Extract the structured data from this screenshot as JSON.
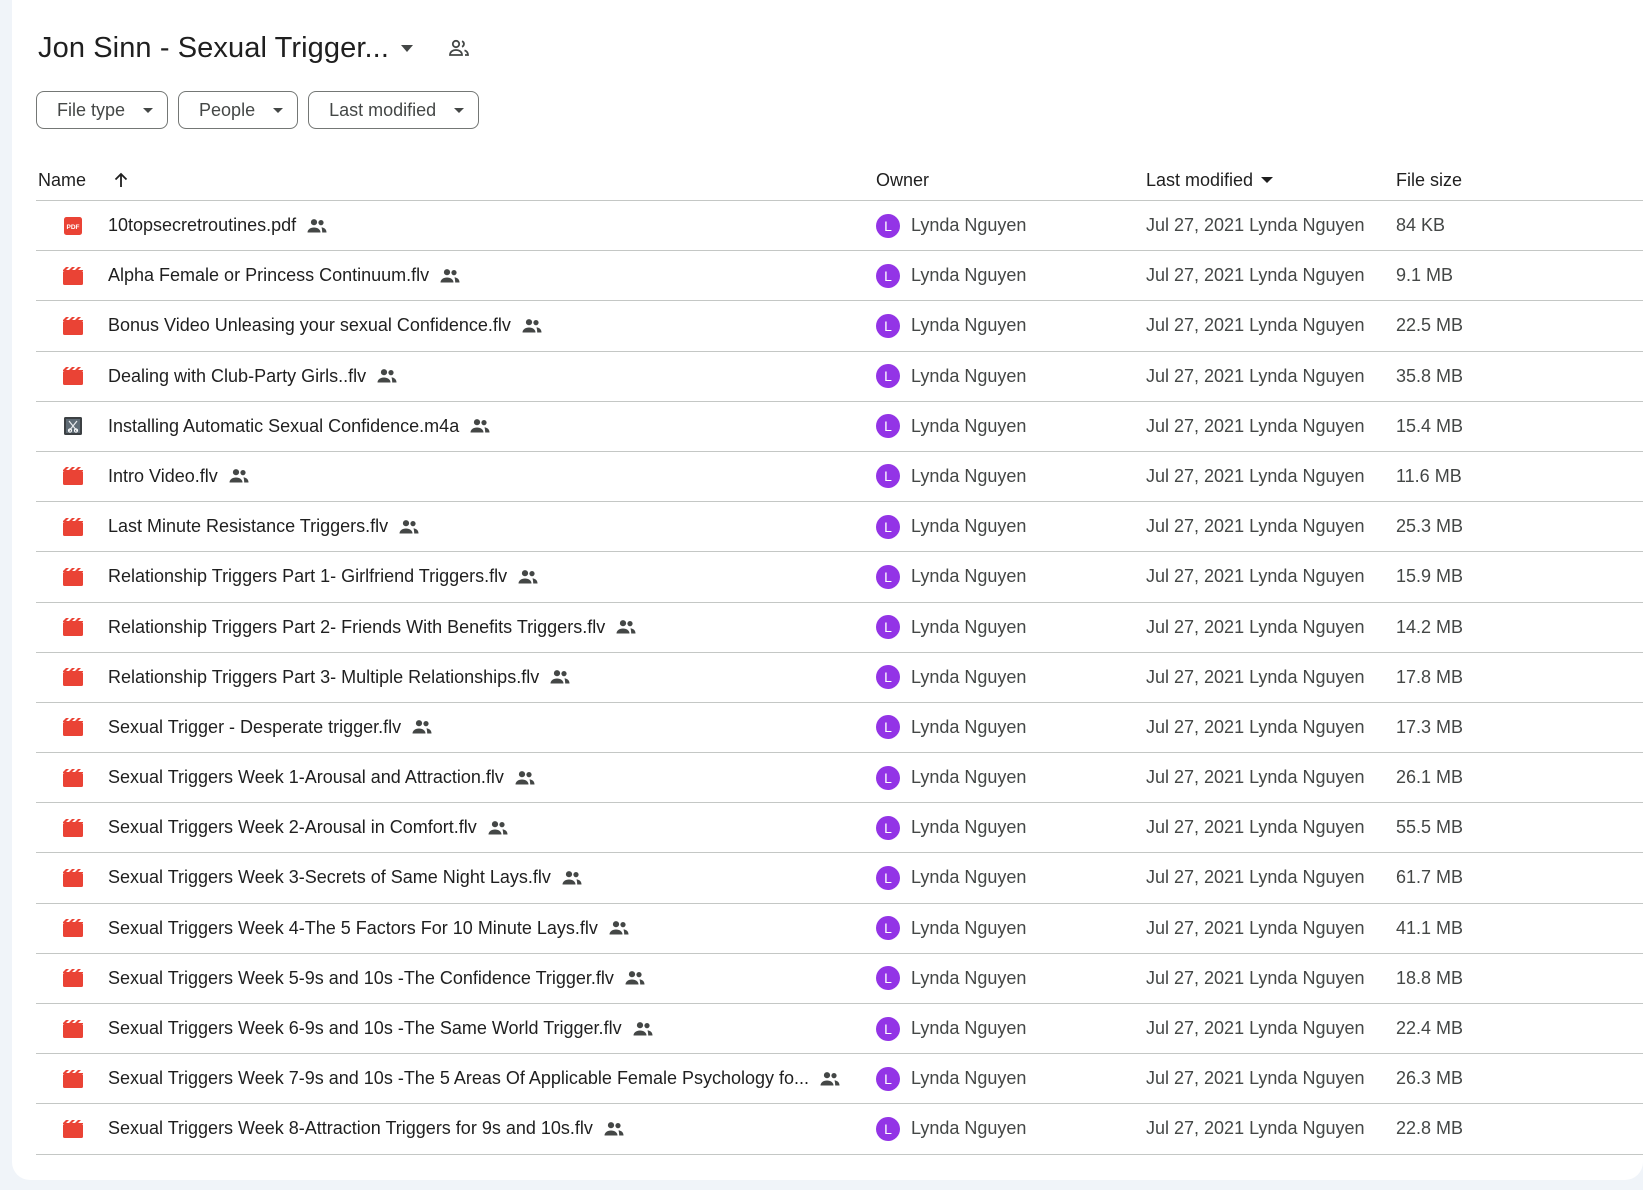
{
  "folder": {
    "title": "Jon Sinn - Sexual Trigger..."
  },
  "filters": [
    "File type",
    "People",
    "Last modified"
  ],
  "columns": {
    "name": "Name",
    "owner": "Owner",
    "last_modified": "Last modified",
    "file_size": "File size"
  },
  "colors": {
    "pdf": "#ea4335",
    "video": "#ea4335",
    "avatar": "#9334e6",
    "audio_thumb": "#3c4043"
  },
  "files": [
    {
      "icon": "pdf-icon",
      "name": "10topsecretroutines.pdf",
      "owner": "Lynda Nguyen",
      "initial": "L",
      "modified": "Jul 27, 2021 Lynda Nguyen",
      "size": "84 KB"
    },
    {
      "icon": "video-icon",
      "name": "Alpha Female or Princess Continuum.flv",
      "owner": "Lynda Nguyen",
      "initial": "L",
      "modified": "Jul 27, 2021 Lynda Nguyen",
      "size": "9.1 MB"
    },
    {
      "icon": "video-icon",
      "name": "Bonus Video Unleasing your sexual Confidence.flv",
      "owner": "Lynda Nguyen",
      "initial": "L",
      "modified": "Jul 27, 2021 Lynda Nguyen",
      "size": "22.5 MB"
    },
    {
      "icon": "video-icon",
      "name": "Dealing with Club-Party Girls..flv",
      "owner": "Lynda Nguyen",
      "initial": "L",
      "modified": "Jul 27, 2021 Lynda Nguyen",
      "size": "35.8 MB"
    },
    {
      "icon": "audio-thumbnail-icon",
      "name": "Installing Automatic Sexual Confidence.m4a",
      "owner": "Lynda Nguyen",
      "initial": "L",
      "modified": "Jul 27, 2021 Lynda Nguyen",
      "size": "15.4 MB"
    },
    {
      "icon": "video-icon",
      "name": "Intro Video.flv",
      "owner": "Lynda Nguyen",
      "initial": "L",
      "modified": "Jul 27, 2021 Lynda Nguyen",
      "size": "11.6 MB"
    },
    {
      "icon": "video-icon",
      "name": "Last Minute Resistance Triggers.flv",
      "owner": "Lynda Nguyen",
      "initial": "L",
      "modified": "Jul 27, 2021 Lynda Nguyen",
      "size": "25.3 MB"
    },
    {
      "icon": "video-icon",
      "name": "Relationship Triggers Part 1- Girlfriend Triggers.flv",
      "owner": "Lynda Nguyen",
      "initial": "L",
      "modified": "Jul 27, 2021 Lynda Nguyen",
      "size": "15.9 MB"
    },
    {
      "icon": "video-icon",
      "name": "Relationship Triggers Part 2- Friends With Benefits Triggers.flv",
      "owner": "Lynda Nguyen",
      "initial": "L",
      "modified": "Jul 27, 2021 Lynda Nguyen",
      "size": "14.2 MB"
    },
    {
      "icon": "video-icon",
      "name": "Relationship Triggers Part 3- Multiple Relationships.flv",
      "owner": "Lynda Nguyen",
      "initial": "L",
      "modified": "Jul 27, 2021 Lynda Nguyen",
      "size": "17.8 MB"
    },
    {
      "icon": "video-icon",
      "name": "Sexual Trigger - Desperate trigger.flv",
      "owner": "Lynda Nguyen",
      "initial": "L",
      "modified": "Jul 27, 2021 Lynda Nguyen",
      "size": "17.3 MB"
    },
    {
      "icon": "video-icon",
      "name": "Sexual Triggers  Week 1-Arousal and Attraction.flv",
      "owner": "Lynda Nguyen",
      "initial": "L",
      "modified": "Jul 27, 2021 Lynda Nguyen",
      "size": "26.1 MB"
    },
    {
      "icon": "video-icon",
      "name": "Sexual Triggers  Week 2-Arousal in Comfort.flv",
      "owner": "Lynda Nguyen",
      "initial": "L",
      "modified": "Jul 27, 2021 Lynda Nguyen",
      "size": "55.5 MB"
    },
    {
      "icon": "video-icon",
      "name": "Sexual Triggers  Week 3-Secrets of Same Night Lays.flv",
      "owner": "Lynda Nguyen",
      "initial": "L",
      "modified": "Jul 27, 2021 Lynda Nguyen",
      "size": "61.7 MB"
    },
    {
      "icon": "video-icon",
      "name": "Sexual Triggers  Week 4-The 5 Factors For 10 Minute Lays.flv",
      "owner": "Lynda Nguyen",
      "initial": "L",
      "modified": "Jul 27, 2021 Lynda Nguyen",
      "size": "41.1 MB"
    },
    {
      "icon": "video-icon",
      "name": "Sexual Triggers  Week 5-9s and 10s -The Confidence Trigger.flv",
      "owner": "Lynda Nguyen",
      "initial": "L",
      "modified": "Jul 27, 2021 Lynda Nguyen",
      "size": "18.8 MB"
    },
    {
      "icon": "video-icon",
      "name": "Sexual Triggers  Week 6-9s and 10s -The Same World Trigger.flv",
      "owner": "Lynda Nguyen",
      "initial": "L",
      "modified": "Jul 27, 2021 Lynda Nguyen",
      "size": "22.4 MB"
    },
    {
      "icon": "video-icon",
      "name": "Sexual Triggers  Week 7-9s and 10s -The 5 Areas Of Applicable Female Psychology fo...",
      "owner": "Lynda Nguyen",
      "initial": "L",
      "modified": "Jul 27, 2021 Lynda Nguyen",
      "size": "26.3 MB"
    },
    {
      "icon": "video-icon",
      "name": "Sexual Triggers  Week 8-Attraction Triggers for 9s and 10s.flv",
      "owner": "Lynda Nguyen",
      "initial": "L",
      "modified": "Jul 27, 2021 Lynda Nguyen",
      "size": "22.8 MB"
    }
  ]
}
